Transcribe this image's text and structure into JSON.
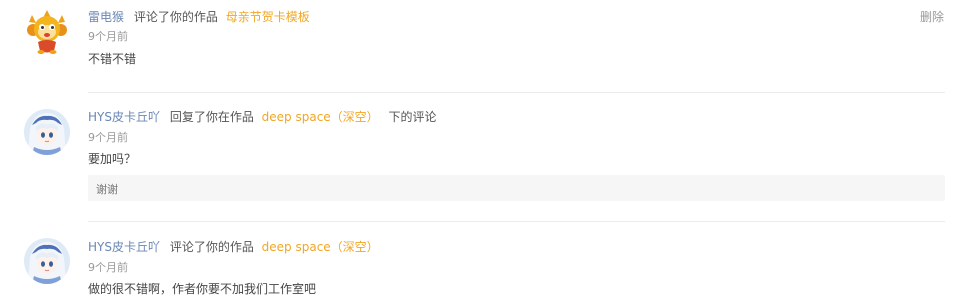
{
  "comments": [
    {
      "user": "雷电猴",
      "action": "评论了你的作品",
      "work": "母亲节贺卡模板",
      "time": "9个月前",
      "content": "不错不错",
      "delete_label": "删除",
      "avatar": "monkey-mascot-avatar"
    },
    {
      "user": "HYS皮卡丘吖",
      "action": "回复了你在作品",
      "work": "deep space（深空）",
      "suffix": "下的评论",
      "time": "9个月前",
      "content": "要加吗？",
      "quoted": "谢谢",
      "avatar": "anime-girl-avatar"
    },
    {
      "user": "HYS皮卡丘吖",
      "action": "评论了你的作品",
      "work": "deep space（深空）",
      "time": "9个月前",
      "content": "做的很不错啊，作者你要不加我们工作室吧",
      "avatar": "anime-girl-avatar"
    }
  ],
  "colors": {
    "username": "#6a87b5",
    "work_link": "#f2a724",
    "muted": "#999999"
  }
}
